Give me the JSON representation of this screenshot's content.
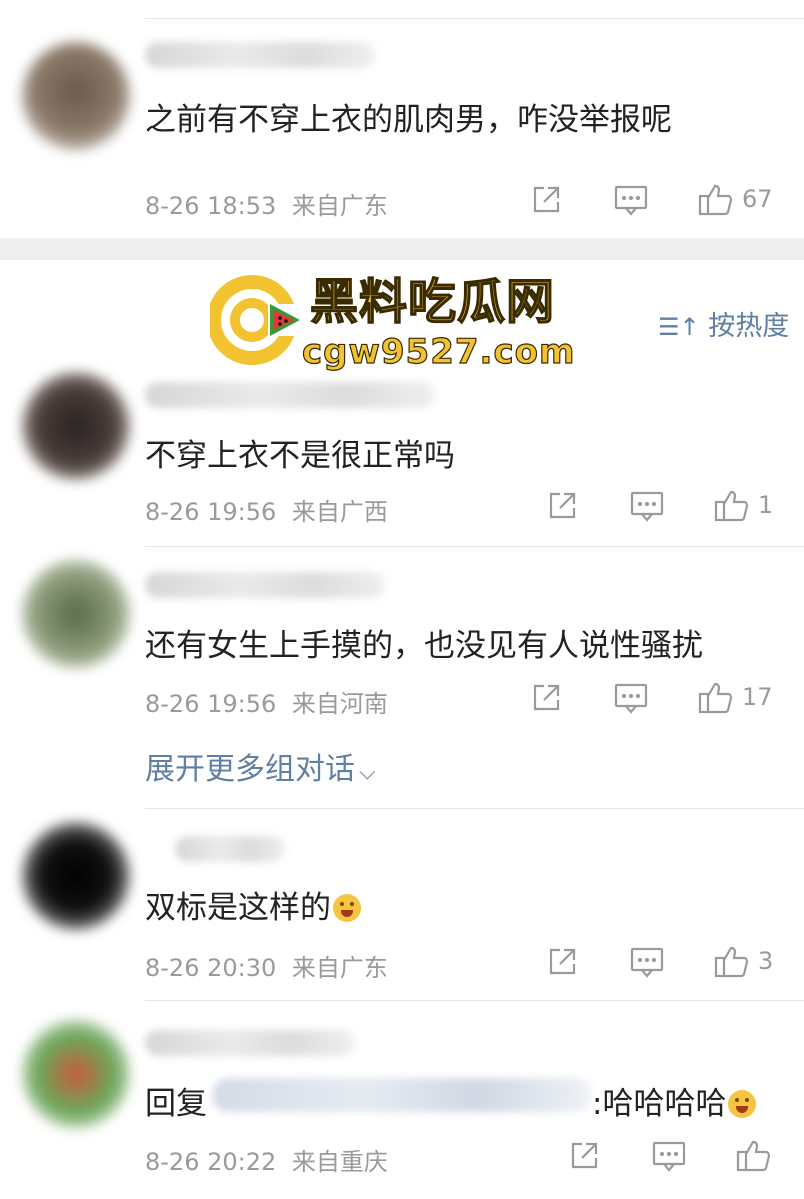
{
  "comments": [
    {
      "text": "之前有不穿上衣的肌肉男，咋没举报呢",
      "time": "8-26 18:53",
      "location": "来自广东",
      "likes": "67"
    },
    {
      "text": "不穿上衣不是很正常吗",
      "time": "8-26 19:56",
      "location": "来自广西",
      "likes": "1"
    },
    {
      "text": "还有女生上手摸的，也没见有人说性骚扰",
      "time": "8-26 19:56",
      "location": "来自河南",
      "likes": "17"
    },
    {
      "text": "双标是这样的",
      "time": "8-26 20:30",
      "location": "来自广东",
      "likes": "3"
    },
    {
      "reply_prefix": "回复",
      "text": ":哈哈哈哈",
      "time": "8-26 20:22",
      "location": "来自重庆",
      "likes": ""
    }
  ],
  "sort_label": "按热度",
  "expand_label": "展开更多组对话",
  "watermark": {
    "title": "黑料吃瓜网",
    "url": "cgw9527.com"
  },
  "colors": {
    "link": "#5f7fa3",
    "meta": "#9a9a9a",
    "watermark_yellow": "#f2c230"
  }
}
